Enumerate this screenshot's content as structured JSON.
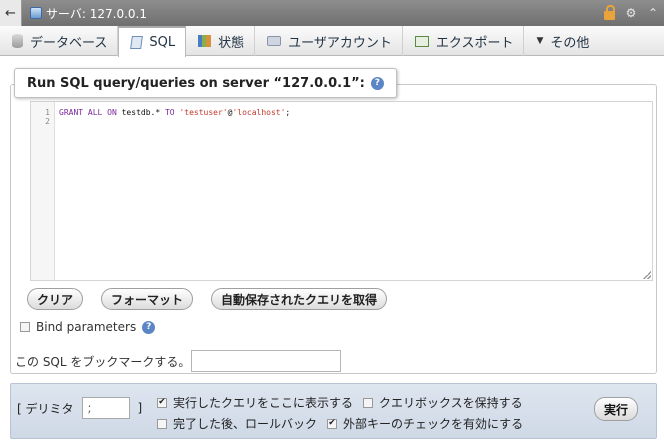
{
  "topbar": {
    "back_label": "←",
    "title": "サーバ: 127.0.0.1"
  },
  "tabs": [
    {
      "label": "データベース",
      "icon": "database-icon"
    },
    {
      "label": "SQL",
      "icon": "sql-icon",
      "active": true
    },
    {
      "label": "状態",
      "icon": "status-icon"
    },
    {
      "label": "ユーザアカウント",
      "icon": "user-accounts-icon"
    },
    {
      "label": "エクスポート",
      "icon": "export-icon"
    },
    {
      "label": "その他",
      "icon": "chevron-down-icon"
    }
  ],
  "query": {
    "heading": "Run SQL query/queries on server “127.0.0.1”:",
    "help": "?",
    "line_numbers": [
      "1",
      "2"
    ],
    "code": {
      "kw1": "GRANT ALL ON",
      "plain1": " testdb.* ",
      "kw2": "TO",
      "plain2": " ",
      "str1": "'testuser'",
      "plain3": "@",
      "str2": "'localhost'",
      "plain4": ";"
    }
  },
  "buttons": {
    "clear": "クリア",
    "format": "フォーマット",
    "autosave": "自動保存されたクエリを取得"
  },
  "bind_parameters": {
    "label": "Bind parameters",
    "checked": false
  },
  "bookmark": {
    "label": "この SQL をブックマークする。",
    "value": ""
  },
  "footer": {
    "delimiter_open": "[ デリミタ",
    "delimiter_value": ";",
    "delimiter_close": "]",
    "options": {
      "show_query": {
        "label": "実行したクエリをここに表示する",
        "mark": "✔"
      },
      "keep_box": {
        "label": "クエリボックスを保持する",
        "mark": ""
      },
      "rollback": {
        "label": "完了した後、ロールバック",
        "mark": ""
      },
      "foreign_keys": {
        "label": "外部キーのチェックを有効にする",
        "mark": "✔"
      }
    },
    "run": "実行"
  },
  "colors": {
    "topbar": "#7f7f7f",
    "footer": "#d6dee9",
    "keyword": "#7a2a9a",
    "string": "#c0392b"
  }
}
